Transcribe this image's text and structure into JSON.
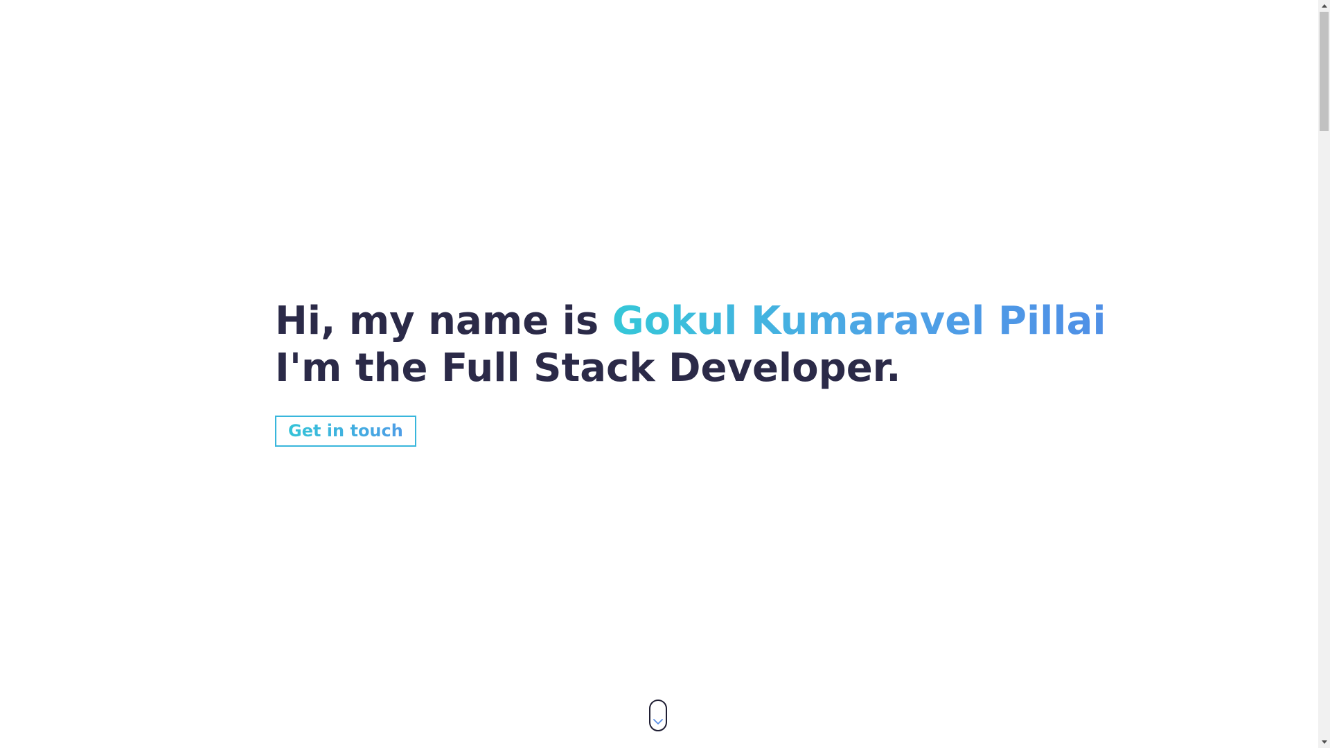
{
  "hero": {
    "greeting": "Hi, my name is ",
    "name": "Gokul Kumaravel Pillai",
    "tagline": "I'm the Full Stack Developer.",
    "cta_label": "Get in touch"
  },
  "scroll_indicator": {
    "icon": "chevron-down-icon"
  },
  "colors": {
    "heading": "#2b2a48",
    "accent_start": "#35c7d8",
    "accent_end": "#4f8fe6",
    "button_border": "#38b6dc"
  }
}
